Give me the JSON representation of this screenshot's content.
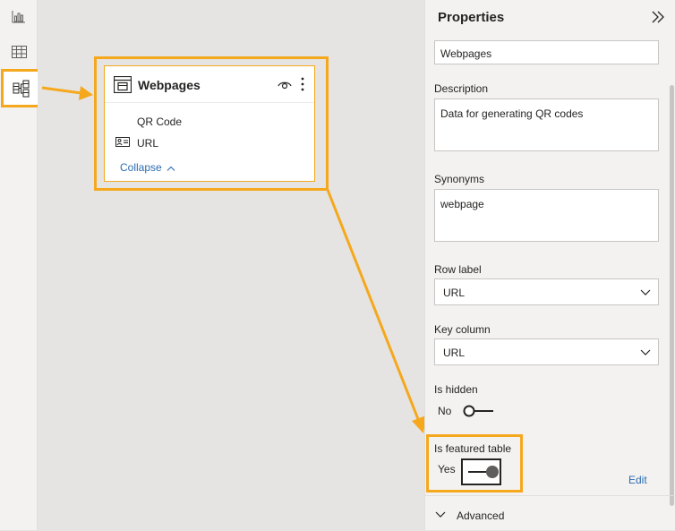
{
  "left_rail": {
    "items": [
      {
        "icon": "report-view-icon"
      },
      {
        "icon": "data-view-icon"
      },
      {
        "icon": "model-view-icon",
        "active": true
      }
    ]
  },
  "canvas": {
    "table_card": {
      "title": "Webpages",
      "fields": [
        "QR Code",
        "URL"
      ],
      "collapse_label": "Collapse"
    }
  },
  "properties": {
    "title": "Properties",
    "name_value": "Webpages",
    "description_label": "Description",
    "description_value": "Data for generating QR codes",
    "synonyms_label": "Synonyms",
    "synonyms_value": "webpage",
    "row_label_label": "Row label",
    "row_label_value": "URL",
    "key_column_label": "Key column",
    "key_column_value": "URL",
    "is_hidden_label": "Is hidden",
    "is_hidden_value": "No",
    "is_featured_label": "Is featured table",
    "is_featured_value": "Yes",
    "edit_label": "Edit",
    "advanced_label": "Advanced"
  },
  "colors": {
    "highlight": "#f5a81c",
    "link": "#2b6cb0"
  }
}
